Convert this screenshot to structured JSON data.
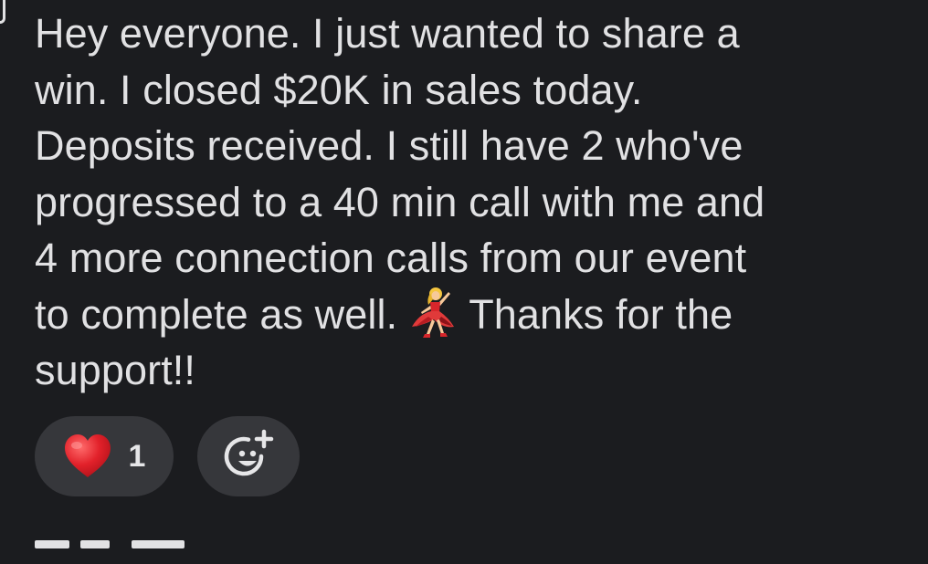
{
  "message": {
    "lines": [
      "Hey everyone. I just wanted to share a",
      "win. I closed $20K in sales today.",
      "Deposits received. I still have 2 who've",
      "progressed to a 40 min call with me and",
      "4 more connection calls from our event",
      "to complete as well."
    ],
    "line6_after_emoji": "Thanks for the",
    "line7": "support!!",
    "inline_emoji": "dancer-emoji"
  },
  "reactions": {
    "heart": {
      "emoji": "heart-icon",
      "count": "1",
      "color": "#e2212a"
    },
    "add_reaction_icon": "add-reaction-icon"
  },
  "colors": {
    "background": "#1b1c1f",
    "text": "#e1e1e3",
    "pill": "#36373b"
  }
}
